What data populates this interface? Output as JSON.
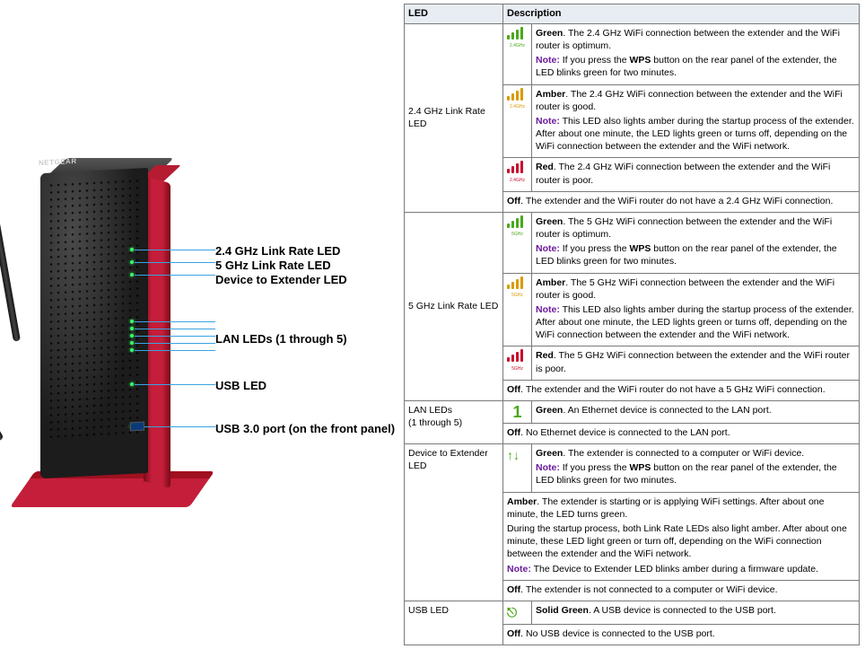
{
  "brand": "NETGEAR",
  "callouts": {
    "link24": "2.4 GHz Link Rate LED",
    "link5": "5 GHz Link Rate LED",
    "d2e": "Device to Extender LED",
    "lan": "LAN LEDs (1 through 5)",
    "usb": "USB LED",
    "usbport": "USB 3.0 port (on the front panel)"
  },
  "table": {
    "headers": {
      "led": "LED",
      "desc": "Description"
    },
    "icon_labels": {
      "g24": "2.4GHz",
      "g5": "5GHz"
    },
    "rows": {
      "r24": {
        "name": "2.4 GHz Link Rate LED",
        "green": {
          "bold": "Green",
          "text": ". The 2.4 GHz WiFi connection between the extender and the WiFi router is optimum.",
          "note_label": "Note:",
          "note": "  If you press the ",
          "wps": "WPS",
          "note2": " button on the rear panel of the extender, the LED blinks green for two minutes."
        },
        "amber": {
          "bold": "Amber",
          "text": ". The 2.4 GHz WiFi connection between the extender and the WiFi router is good.",
          "note_label": "Note:",
          "note": "  This LED also lights amber during the startup process of the extender. After about one minute, the LED lights green or turns off, depending on the WiFi connection between the extender and the WiFi network."
        },
        "red": {
          "bold": "Red",
          "text": ". The 2.4 GHz WiFi connection between the extender and the WiFi router is poor."
        },
        "off": {
          "bold": "Off",
          "text": ". The extender and the WiFi router do not have a 2.4 GHz WiFi connection."
        }
      },
      "r5": {
        "name": "5 GHz Link Rate LED",
        "green": {
          "bold": "Green",
          "text": ". The 5 GHz WiFi connection between the extender and the WiFi router is optimum.",
          "note_label": "Note:",
          "note": "  If you press the ",
          "wps": "WPS",
          "note2": " button on the rear panel of the extender, the LED blinks green for two minutes."
        },
        "amber": {
          "bold": "Amber",
          "text": ". The 5 GHz WiFi connection between the extender and the WiFi router is good.",
          "note_label": "Note:",
          "note": "  This LED also lights amber during the startup process of the extender. After about one minute, the LED lights green or turns off, depending on the WiFi connection between the extender and the WiFi network."
        },
        "red": {
          "bold": "Red",
          "text": ". The 5 GHz WiFi connection between the extender and the WiFi router is poor."
        },
        "off": {
          "bold": "Off",
          "text": ". The extender and the WiFi router do not have a 5 GHz WiFi connection."
        }
      },
      "lan": {
        "name": "LAN LEDs",
        "name2": "(1 through 5)",
        "green": {
          "bold": "Green",
          "text": ". An Ethernet device is connected to the LAN port."
        },
        "off": {
          "bold": "Off",
          "text": ". No Ethernet device is connected to the LAN port."
        }
      },
      "d2e": {
        "name": "Device to Extender LED",
        "green": {
          "bold": "Green",
          "text": ". The extender is connected to a computer or WiFi device.",
          "note_label": "Note:",
          "note": "  If you press the ",
          "wps": "WPS",
          "note2": " button on the rear panel of the extender, the LED blinks green for two minutes."
        },
        "amber": {
          "bold": "Amber",
          "text": ". The extender is starting or is applying WiFi settings. After about one minute, the LED turns green.",
          "text2": "During the startup process, both Link Rate LEDs also light amber. After about one minute, these LED light green or turn off, depending on the WiFi connection between the extender and the WiFi network.",
          "note_label": "Note:",
          "note": "  The Device to Extender LED blinks amber during a firmware update."
        },
        "off": {
          "bold": "Off",
          "text": ". The extender is not connected to a computer or WiFi device."
        }
      },
      "usb": {
        "name": "USB LED",
        "green": {
          "bold": "Solid Green",
          "text": ". A USB device is connected to the USB port."
        },
        "off": {
          "bold": "Off",
          "text": ". No USB device is connected to the USB port."
        }
      }
    }
  }
}
